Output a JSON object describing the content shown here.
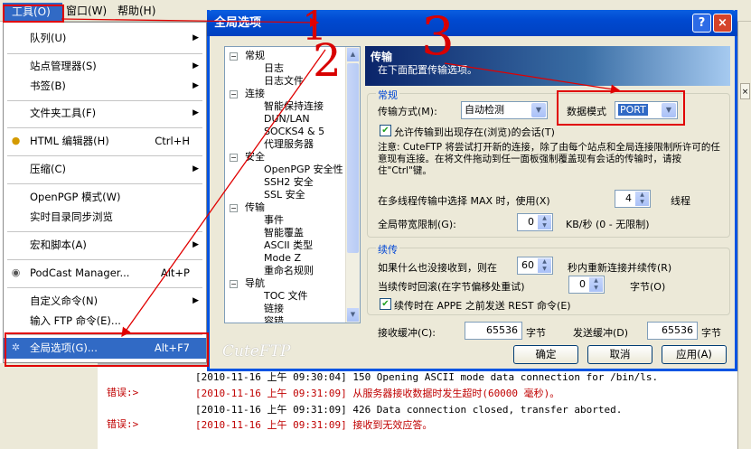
{
  "menubar": {
    "tools": "工具(O)",
    "window": "窗口(W)",
    "help": "帮助(H)"
  },
  "menu": {
    "queue": {
      "label": "队列(U)"
    },
    "site_manager": {
      "label": "站点管理器(S)"
    },
    "bookmarks": {
      "label": "书签(B)"
    },
    "folder_tools": {
      "label": "文件夹工具(F)"
    },
    "html_editor": {
      "label": "HTML 编辑器(H)",
      "shortcut": "Ctrl+H"
    },
    "compress": {
      "label": "压缩(C)"
    },
    "openpgp": {
      "label": "OpenPGP 模式(W)"
    },
    "realtime_sync": {
      "label": "实时目录同步浏览"
    },
    "macros": {
      "label": "宏和脚本(A)"
    },
    "podcast": {
      "label": "PodCast Manager...",
      "shortcut": "Alt+P"
    },
    "custom_cmd": {
      "label": "自定义命令(N)"
    },
    "ftp_cmd": {
      "label": "输入 FTP 命令(E)..."
    },
    "global_options": {
      "label": "全局选项(G)...",
      "shortcut": "Alt+F7"
    }
  },
  "dialog": {
    "title": "全局选项",
    "help_btn": "?",
    "close_btn": "×",
    "watermark": "CuteFTP",
    "tree": {
      "general": "常规",
      "log": "日志",
      "log_file": "日志文件",
      "connection": "连接",
      "smart_keepalive": "智能保持连接",
      "dun_lan": "DUN/LAN",
      "socks": "SOCKS4 & 5",
      "proxy": "代理服务器",
      "security": "安全",
      "openpgp": "OpenPGP 安全性",
      "ssh2": "SSH2 安全",
      "ssl": "SSL 安全",
      "transfer": "传输",
      "events": "事件",
      "smart_overwrite": "智能覆盖",
      "ascii": "ASCII 类型",
      "modez": "Mode Z",
      "rename_rules": "重命名规则",
      "navigation": "导航",
      "toc": "TOC 文件",
      "links": "链接",
      "errors": "容错"
    },
    "panel": {
      "title": "传输",
      "subtitle": "在下面配置传输选项。",
      "general_group": "常规",
      "transfer_method_label": "传输方式(M):",
      "transfer_method_value": "自动检测",
      "data_mode_label": "数据模式",
      "data_mode_value": "PORT",
      "allow_transfer_label": "允许传输到出现存在(浏览)的会话(T)",
      "note": "注意: CuteFTP 将尝试打开新的连接，除了由每个站点和全局连接限制所许可的任意现有连接。在将文件拖动到任一面板强制覆盖现有会话的传输时，请按住\"Ctrl\"键。",
      "multithread_label": "在多线程传输中选择 MAX 时，使用(X)",
      "multithread_value": "4",
      "threads_unit": "线程",
      "bandwidth_label": "全局带宽限制(G):",
      "bandwidth_value": "0",
      "bandwidth_unit": "KB/秒 (0 - 无限制)",
      "resume_group": "续传",
      "resume_label": "如果什么也没接收到，则在",
      "resume_value": "60",
      "resume_unit": "秒内重新连接并续传(R)",
      "rollback_label": "当续传时回滚(在字节偏移处重试)",
      "rollback_value": "0",
      "rollback_unit": "字节(O)",
      "appe_label": "续传时在 APPE 之前发送 REST 命令(E)",
      "recv_buffer_label": "接收缓冲(C):",
      "recv_buffer_value": "65536",
      "send_buffer_label": "发送缓冲(D)",
      "send_buffer_value": "65536",
      "bytes_unit": "字节"
    },
    "ok": "确定",
    "cancel": "取消",
    "apply": "应用(A)"
  },
  "log": [
    {
      "prefix": "",
      "text": "[2010-11-16 上午 09:30:04] 150 Opening ASCII mode data connection for /bin/ls.",
      "color": "#000000"
    },
    {
      "prefix": "错误:>",
      "text": "[2010-11-16 上午 09:31:09] 从服务器接收数据时发生超时(60000 毫秒)。",
      "color": "#c00000"
    },
    {
      "prefix": "",
      "text": "[2010-11-16 上午 09:31:09] 426 Data connection closed, transfer aborted.",
      "color": "#000000"
    },
    {
      "prefix": "错误:>",
      "text": "[2010-11-16 上午 09:31:09] 接收到无效应答。",
      "color": "#c00000"
    }
  ],
  "annotations": {
    "n1": "1",
    "n2": "2",
    "n3": "3"
  },
  "colors": {
    "menu_highlight": "#316ac5",
    "annotation_red": "#e00000",
    "xp_blue": "#0054e3"
  }
}
